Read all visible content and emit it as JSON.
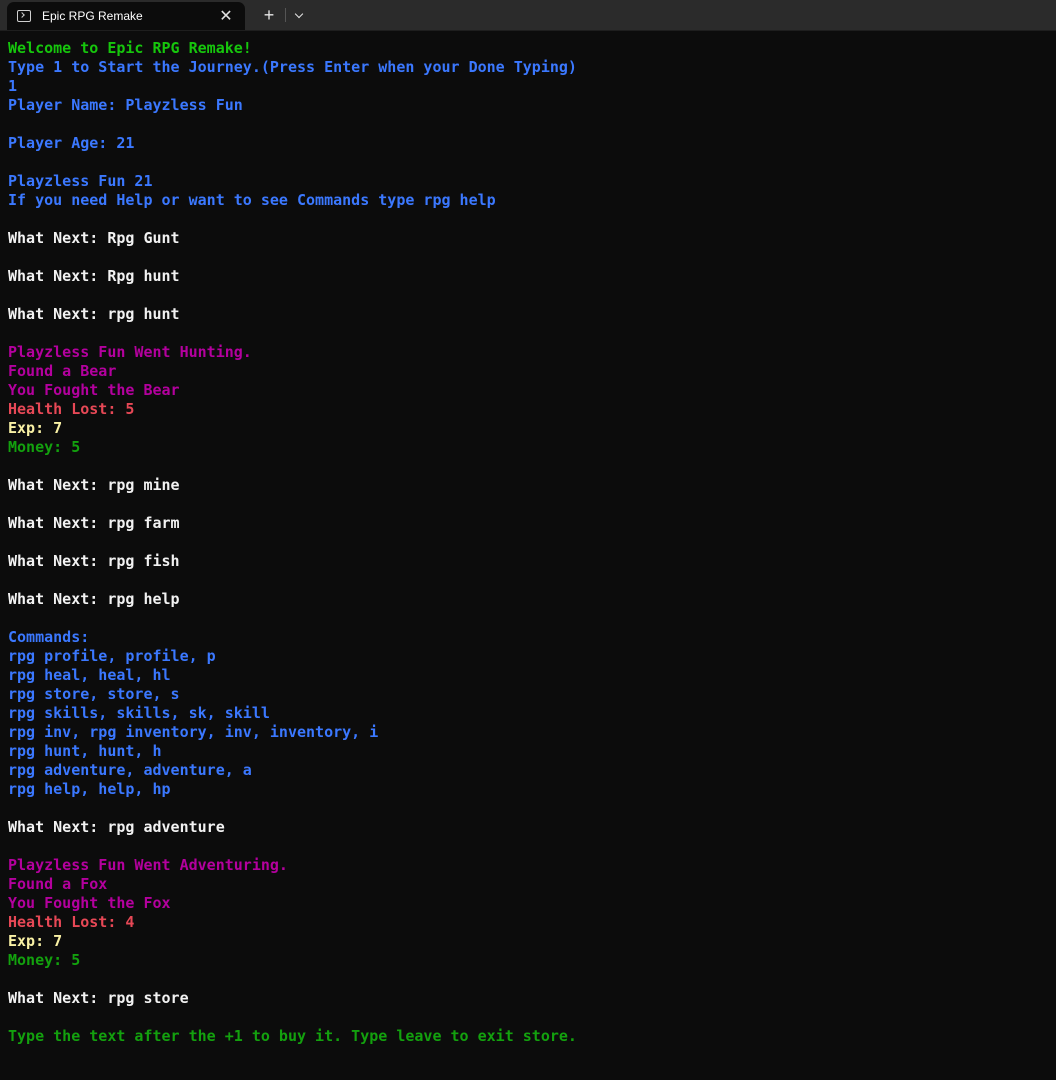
{
  "window": {
    "tab_title": "Epic RPG Remake",
    "tab_icon": "terminal-icon",
    "close_icon": "close-icon",
    "new_tab_label": "+",
    "dropdown_icon": "chevron-down-icon"
  },
  "colors": {
    "green": "#16c60c",
    "blue": "#3b78ff",
    "white": "#f2f2f2",
    "magenta": "#b4009e",
    "red": "#e74856",
    "yellow": "#f9f1a5",
    "darkgreen": "#13a10e",
    "background": "#0c0c0c"
  },
  "terminal": {
    "lines": [
      {
        "text": "Welcome to Epic RPG Remake!",
        "color": "green"
      },
      {
        "text": "Type 1 to Start the Journey.(Press Enter when your Done Typing)",
        "color": "blue"
      },
      {
        "text": "1",
        "color": "blue"
      },
      {
        "text": "Player Name: Playzless Fun",
        "color": "blue"
      },
      {
        "text": "",
        "color": "blue"
      },
      {
        "text": "Player Age: 21",
        "color": "blue"
      },
      {
        "text": "",
        "color": "blue"
      },
      {
        "text": "Playzless Fun 21",
        "color": "blue"
      },
      {
        "text": "If you need Help or want to see Commands type rpg help",
        "color": "blue"
      },
      {
        "text": "",
        "color": "white"
      },
      {
        "text": "What Next: Rpg Gunt",
        "color": "white"
      },
      {
        "text": "",
        "color": "white"
      },
      {
        "text": "What Next: Rpg hunt",
        "color": "white"
      },
      {
        "text": "",
        "color": "white"
      },
      {
        "text": "What Next: rpg hunt",
        "color": "white"
      },
      {
        "text": "",
        "color": "white"
      },
      {
        "text": "Playzless Fun Went Hunting.",
        "color": "magenta"
      },
      {
        "text": "Found a Bear",
        "color": "magenta"
      },
      {
        "text": "You Fought the Bear",
        "color": "magenta"
      },
      {
        "text": "Health Lost: 5",
        "color": "red"
      },
      {
        "text": "Exp: 7",
        "color": "yellow"
      },
      {
        "text": "Money: 5",
        "color": "darkgreen"
      },
      {
        "text": "",
        "color": "white"
      },
      {
        "text": "What Next: rpg mine",
        "color": "white"
      },
      {
        "text": "",
        "color": "white"
      },
      {
        "text": "What Next: rpg farm",
        "color": "white"
      },
      {
        "text": "",
        "color": "white"
      },
      {
        "text": "What Next: rpg fish",
        "color": "white"
      },
      {
        "text": "",
        "color": "white"
      },
      {
        "text": "What Next: rpg help",
        "color": "white"
      },
      {
        "text": "",
        "color": "white"
      },
      {
        "text": "Commands:",
        "color": "blue"
      },
      {
        "text": "rpg profile, profile, p",
        "color": "blue"
      },
      {
        "text": "rpg heal, heal, hl",
        "color": "blue"
      },
      {
        "text": "rpg store, store, s",
        "color": "blue"
      },
      {
        "text": "rpg skills, skills, sk, skill",
        "color": "blue"
      },
      {
        "text": "rpg inv, rpg inventory, inv, inventory, i",
        "color": "blue"
      },
      {
        "text": "rpg hunt, hunt, h",
        "color": "blue"
      },
      {
        "text": "rpg adventure, adventure, a",
        "color": "blue"
      },
      {
        "text": "rpg help, help, hp",
        "color": "blue"
      },
      {
        "text": "",
        "color": "white"
      },
      {
        "text": "What Next: rpg adventure",
        "color": "white"
      },
      {
        "text": "",
        "color": "white"
      },
      {
        "text": "Playzless Fun Went Adventuring.",
        "color": "magenta"
      },
      {
        "text": "Found a Fox",
        "color": "magenta"
      },
      {
        "text": "You Fought the Fox",
        "color": "magenta"
      },
      {
        "text": "Health Lost: 4",
        "color": "red"
      },
      {
        "text": "Exp: 7",
        "color": "yellow"
      },
      {
        "text": "Money: 5",
        "color": "darkgreen"
      },
      {
        "text": "",
        "color": "white"
      },
      {
        "text": "What Next: rpg store",
        "color": "white"
      },
      {
        "text": "",
        "color": "white"
      },
      {
        "text": "Type the text after the +1 to buy it. Type leave to exit store.",
        "color": "darkgreen"
      }
    ]
  }
}
